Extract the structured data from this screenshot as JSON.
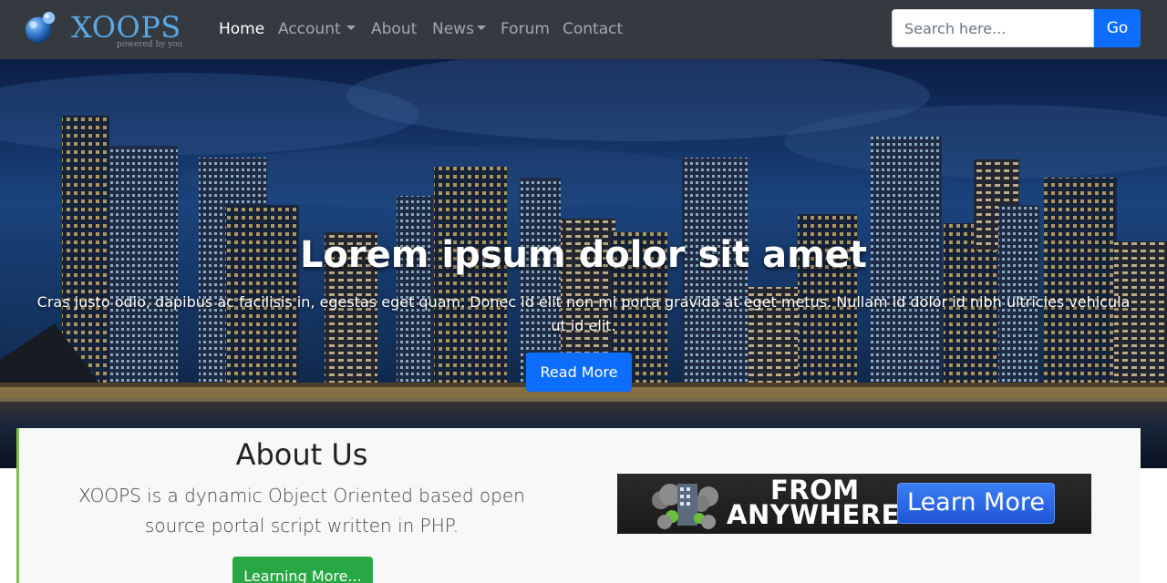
{
  "brand": {
    "name": "XOOPS",
    "tagline": "powered by you"
  },
  "nav": {
    "items": [
      {
        "label": "Home",
        "active": true
      },
      {
        "label": "Account",
        "dropdown": true
      },
      {
        "label": "About"
      },
      {
        "label": "News",
        "dropdown": true
      },
      {
        "label": "Forum"
      },
      {
        "label": "Contact"
      }
    ]
  },
  "search": {
    "placeholder": "Search here...",
    "button_label": "Go"
  },
  "hero": {
    "title": "Lorem ipsum dolor sit amet",
    "text": "Cras justo odio, dapibus ac facilisis in, egestas eget quam. Donec id elit non mi porta gravida at eget metus. Nullam id dolor id nibh ultricies vehicula ut id elit.",
    "button_label": "Read More"
  },
  "about": {
    "title": "About Us",
    "text": "XOOPS is a dynamic Object Oriented based open source portal script written in PHP.",
    "button_label": "Learning More..."
  },
  "banner": {
    "line1": "FROM",
    "line2": "ANYWHERE",
    "button_label": "Learn More"
  },
  "colors": {
    "navbar": "#343a40",
    "primary": "#0d6efd",
    "success": "#28a745",
    "brand_blue": "#5aa9e6",
    "about_accent": "#7dc242"
  }
}
